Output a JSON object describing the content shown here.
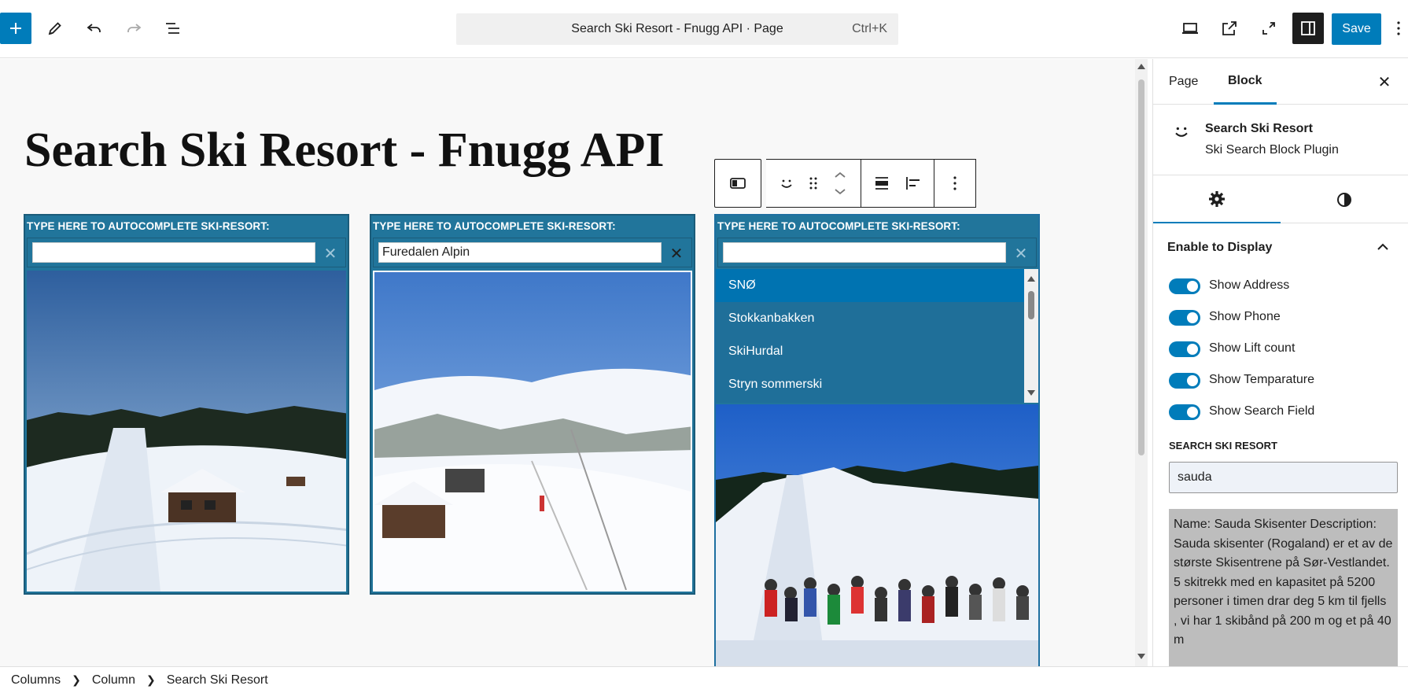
{
  "topbar": {
    "command_bar_title": "Search Ski Resort - Fnugg API · Page",
    "command_bar_shortcut": "Ctrl+K",
    "save_label": "Save"
  },
  "canvas": {
    "page_title": "Search Ski Resort - Fnugg API",
    "blocks": [
      {
        "label": "TYPE HERE TO AUTOCOMPLETE SKI-RESORT:",
        "input_value": ""
      },
      {
        "label": "TYPE HERE TO AUTOCOMPLETE SKI-RESORT:",
        "input_value": "Furedalen Alpin"
      },
      {
        "label": "TYPE HERE TO AUTOCOMPLETE SKI-RESORT:",
        "input_value": ""
      }
    ],
    "dropdown": {
      "items": [
        "SNØ",
        "Stokkanbakken",
        "SkiHurdal",
        "Stryn sommerski"
      ],
      "active_index": 0
    }
  },
  "breadcrumb": {
    "items": [
      "Columns",
      "Column",
      "Search Ski Resort"
    ]
  },
  "sidebar": {
    "tabs": [
      "Page",
      "Block"
    ],
    "active_tab": "Block",
    "block_card": {
      "title": "Search Ski Resort",
      "description": "Ski Search Block Plugin"
    },
    "panel_title": "Enable to Display",
    "toggles": [
      {
        "label": "Show Address",
        "on": true
      },
      {
        "label": "Show Phone",
        "on": true
      },
      {
        "label": "Show Lift count",
        "on": true
      },
      {
        "label": "Show Temparature",
        "on": true
      },
      {
        "label": "Show Search Field",
        "on": true
      }
    ],
    "search_label": "Search Ski Resort",
    "search_value": "sauda",
    "result_text": "Name: Sauda Skisenter Description: Sauda skisenter (Rogaland) er et av de største Skisentrene på Sør-Vestlandet. 5 skitrekk med en kapasitet på 5200 personer i timen drar deg 5 km til fjells , vi har 1 skibånd på 200 m og et på 40 m"
  },
  "colors": {
    "accent": "#007cba",
    "block_bg": "#21759b",
    "dropdown_active": "#0073b1",
    "result_bg": "#bdbdbd"
  }
}
